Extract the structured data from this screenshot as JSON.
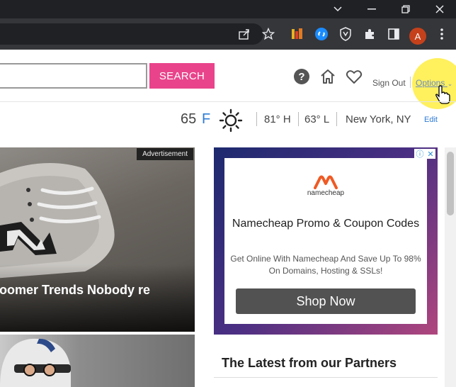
{
  "browser": {
    "colors": {
      "titlebar": "#202124",
      "toolbar": "#35363a"
    },
    "avatar_initial": "A",
    "icons": [
      "share-icon",
      "star-icon",
      "extension-stack-icon",
      "shazam-extension-icon",
      "shield-extension-icon",
      "puzzle-extensions-icon",
      "sidepanel-icon",
      "kebab-menu-icon"
    ]
  },
  "header": {
    "search_input_value": "",
    "search_button": "SEARCH",
    "sign_out": "Sign Out",
    "options": "Options"
  },
  "weather": {
    "temp": "65",
    "unit": "F",
    "high": "81° H",
    "low": "63° L",
    "location": "New York, NY",
    "edit": "Edit"
  },
  "feature": {
    "ad_tag": "Advertisement",
    "title": "Boomer Trends Nobody re"
  },
  "sidebar_ad": {
    "brand": "namecheap",
    "title": "Namecheap Promo & Coupon Codes",
    "description": "Get Online With Namecheap And Save Up To 98% On Domains, Hosting & SSLs!",
    "button": "Shop Now"
  },
  "partners": {
    "heading": "The Latest from our Partners"
  },
  "colors": {
    "accent": "#e9448b",
    "link": "#2e7bd6",
    "cursor_highlight": "#ffeb28"
  }
}
